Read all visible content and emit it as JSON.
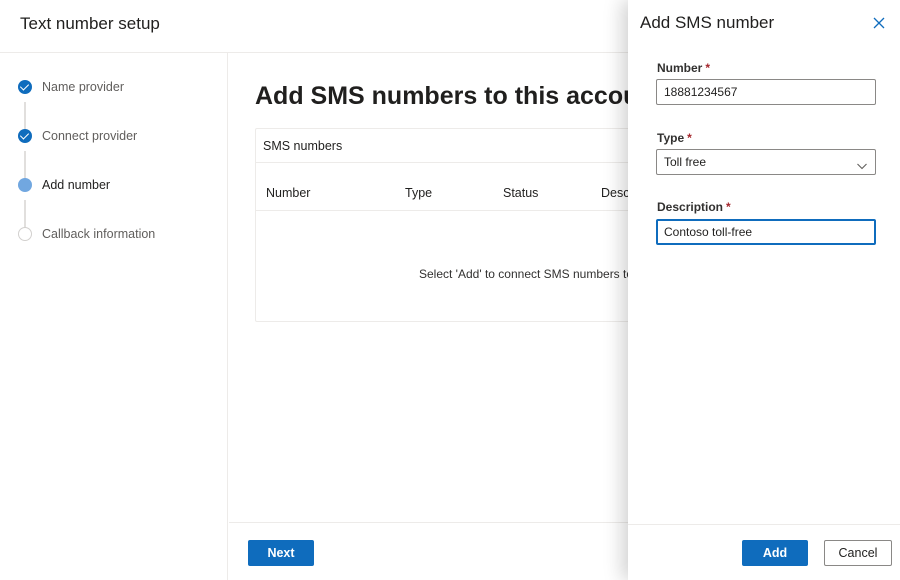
{
  "header": {
    "title": "Text number setup"
  },
  "stepper": {
    "steps": [
      {
        "label": "Name provider",
        "state": "done"
      },
      {
        "label": "Connect provider",
        "state": "done"
      },
      {
        "label": "Add number",
        "state": "current"
      },
      {
        "label": "Callback information",
        "state": "pending"
      }
    ]
  },
  "main": {
    "title": "Add SMS numbers to this account",
    "table": {
      "title": "SMS numbers",
      "columns": [
        "Number",
        "Type",
        "Status",
        "Description"
      ],
      "empty_message": "Select 'Add' to connect SMS numbers to this account."
    },
    "next_label": "Next"
  },
  "panel": {
    "title": "Add SMS number",
    "close_icon": "close-icon",
    "fields": {
      "number": {
        "label": "Number",
        "required": "*",
        "value": "18881234567"
      },
      "type": {
        "label": "Type",
        "required": "*",
        "value": "Toll free"
      },
      "description": {
        "label": "Description",
        "required": "*",
        "value": "Contoso toll-free"
      }
    },
    "add_label": "Add",
    "cancel_label": "Cancel"
  },
  "colors": {
    "accent": "#0f6cbd",
    "required": "#a4262c",
    "current_step": "#71a7e0"
  }
}
